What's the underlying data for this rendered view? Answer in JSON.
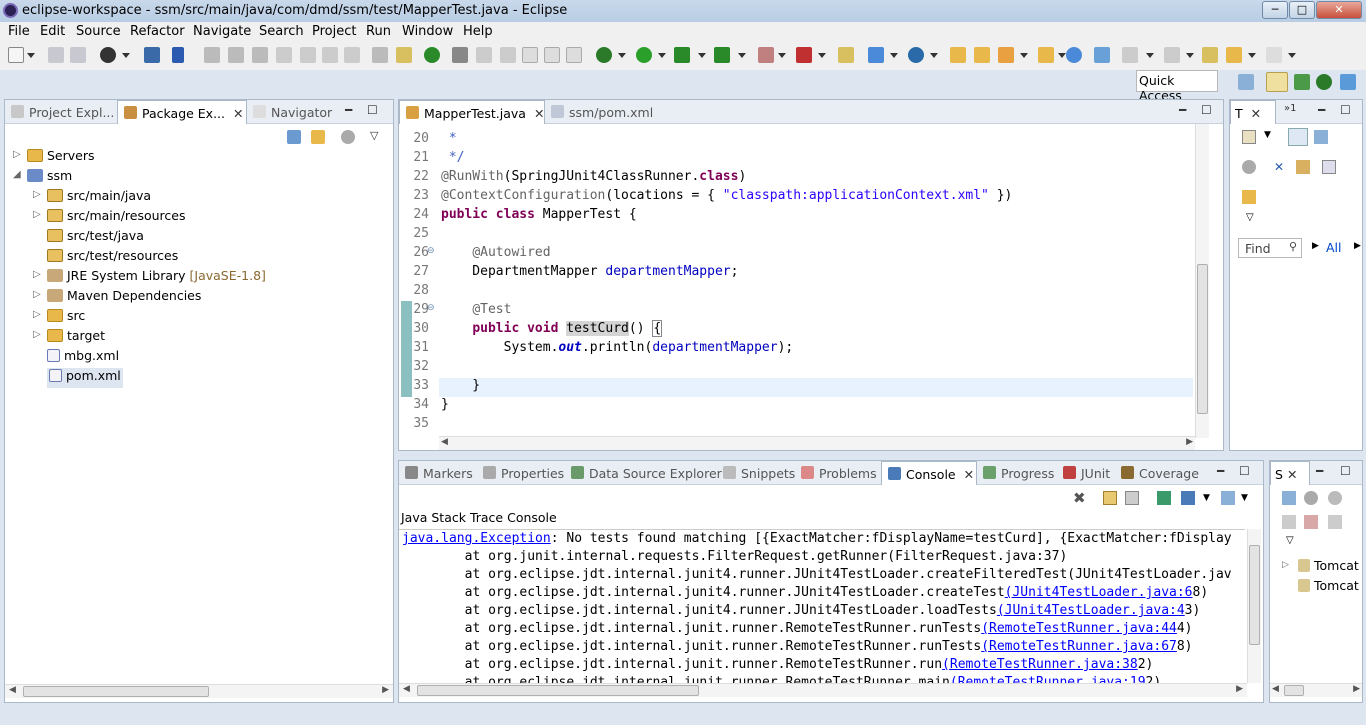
{
  "window": {
    "title": "eclipse-workspace - ssm/src/main/java/com/dmd/ssm/test/MapperTest.java - Eclipse",
    "btn_min": "─",
    "btn_max": "□",
    "btn_close": "✕"
  },
  "menu": [
    "File",
    "Edit",
    "Source",
    "Refactor",
    "Navigate",
    "Search",
    "Project",
    "Run",
    "Window",
    "Help"
  ],
  "quick_access": "Quick Access",
  "left_panel": {
    "tabs": [
      "Project Expl...",
      "Package Ex...",
      "Navigator"
    ],
    "tree": [
      {
        "label": "Servers",
        "depth": 0,
        "arrow": "▷"
      },
      {
        "label": "ssm",
        "depth": 0,
        "arrow": "◢"
      },
      {
        "label": "src/main/java",
        "depth": 1,
        "arrow": "▷"
      },
      {
        "label": "src/main/resources",
        "depth": 1,
        "arrow": "▷"
      },
      {
        "label": "src/test/java",
        "depth": 1,
        "arrow": ""
      },
      {
        "label": "src/test/resources",
        "depth": 1,
        "arrow": ""
      },
      {
        "label": "JRE System Library",
        "extra": "[JavaSE-1.8]",
        "depth": 1,
        "arrow": "▷"
      },
      {
        "label": "Maven Dependencies",
        "depth": 1,
        "arrow": "▷"
      },
      {
        "label": "src",
        "depth": 1,
        "arrow": "▷"
      },
      {
        "label": "target",
        "depth": 1,
        "arrow": "▷"
      },
      {
        "label": "mbg.xml",
        "depth": 1,
        "arrow": ""
      },
      {
        "label": "pom.xml",
        "depth": 1,
        "arrow": ""
      }
    ]
  },
  "editor": {
    "tabs": [
      "MapperTest.java",
      "ssm/pom.xml"
    ],
    "lines": [
      "20",
      "21",
      "22",
      "23",
      "24",
      "25",
      "26",
      "27",
      "28",
      "29",
      "30",
      "31",
      "32",
      "33",
      "34",
      "35"
    ]
  },
  "right_panel": {
    "tab": "T",
    "find": "Find",
    "all": "All"
  },
  "bottom_panel": {
    "tabs": [
      "Markers",
      "Properties",
      "Data Source Explorer",
      "Snippets",
      "Problems",
      "Console",
      "Progress",
      "JUnit",
      "Coverage"
    ],
    "console_title": "Java Stack Trace Console",
    "exception": "java.lang.Exception",
    "exception_msg": ": No tests found matching [{ExactMatcher:fDisplayName=testCurd], {ExactMatcher:fDisplay",
    "trace": [
      {
        "pre": "        at org.junit.internal.requests.FilterRequest.getRunner(FilterRequest.java:37)",
        "link": "",
        "post": ""
      },
      {
        "pre": "        at org.eclipse.jdt.internal.junit4.runner.JUnit4TestLoader.createFilteredTest(JUnit4TestLoader.jav",
        "link": "",
        "post": ""
      },
      {
        "pre": "        at org.eclipse.jdt.internal.junit4.runner.JUnit4TestLoader.createTest",
        "link": "(JUnit4TestLoader.java:6",
        "post": "8)"
      },
      {
        "pre": "        at org.eclipse.jdt.internal.junit4.runner.JUnit4TestLoader.loadTests",
        "link": "(JUnit4TestLoader.java:4",
        "post": "3)"
      },
      {
        "pre": "        at org.eclipse.jdt.internal.junit.runner.RemoteTestRunner.runTests",
        "link": "(RemoteTestRunner.java:44",
        "post": "4)"
      },
      {
        "pre": "        at org.eclipse.jdt.internal.junit.runner.RemoteTestRunner.runTests",
        "link": "(RemoteTestRunner.java:67",
        "post": "8)"
      },
      {
        "pre": "        at org.eclipse.jdt.internal.junit.runner.RemoteTestRunner.run",
        "link": "(RemoteTestRunner.java:38",
        "post": "2)"
      },
      {
        "pre": "        at org.eclipse.jdt.internal.junit.runner.RemoteTestRunner.main",
        "link": "(RemoteTestRunner.java:19",
        "post": "2)"
      }
    ]
  },
  "servers_panel": {
    "tab": "S",
    "items": [
      "Tomcat",
      "Tomcat"
    ]
  }
}
